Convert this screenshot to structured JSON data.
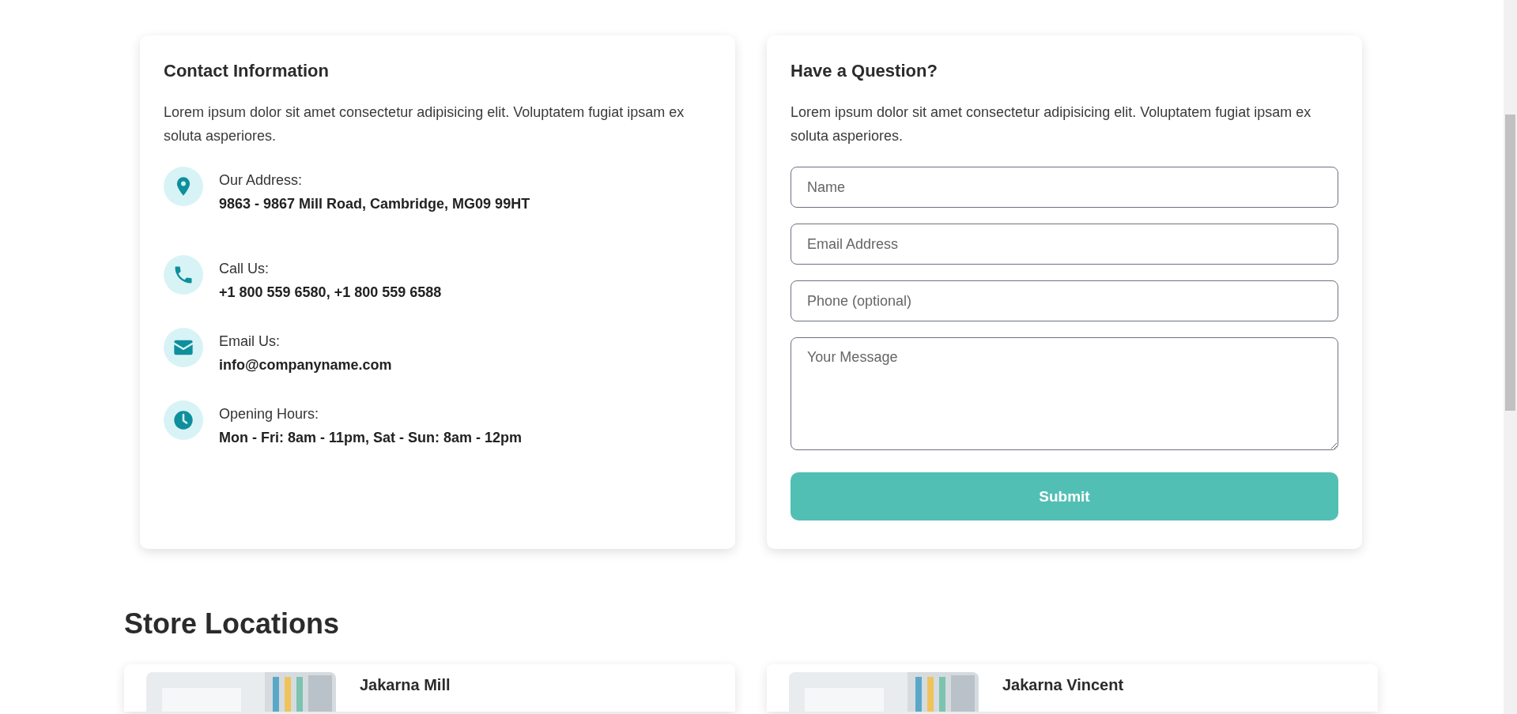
{
  "contact": {
    "title": "Contact Information",
    "intro": "Lorem ipsum dolor sit amet consectetur adipisicing elit. Voluptatem fugiat ipsam ex soluta asperiores.",
    "items": [
      {
        "kind": "pin",
        "label": "Our Address:",
        "value": "9863 - 9867 Mill Road, Cambridge, MG09 99HT"
      },
      {
        "kind": "phone",
        "label": "Call Us:",
        "value": "+1 800 559 6580, +1 800 559 6588"
      },
      {
        "kind": "mail",
        "label": "Email Us:",
        "value": "info@companyname.com"
      },
      {
        "kind": "clock",
        "label": "Opening Hours:",
        "value": "Mon - Fri: 8am - 11pm, Sat - Sun: 8am - 12pm"
      }
    ]
  },
  "question": {
    "title": "Have a Question?",
    "intro": "Lorem ipsum dolor sit amet consectetur adipisicing elit. Voluptatem fugiat ipsam ex soluta asperiores.",
    "fields": [
      {
        "kind": "input",
        "placeholder": "Name"
      },
      {
        "kind": "input",
        "placeholder": "Email Address"
      },
      {
        "kind": "input",
        "placeholder": "Phone (optional)"
      },
      {
        "kind": "textarea",
        "placeholder": "Your Message"
      }
    ],
    "submit": "Submit"
  },
  "stores": {
    "title": "Store Locations",
    "items": [
      {
        "name": "Jakarna Mill"
      },
      {
        "name": "Jakarna Vincent"
      }
    ]
  }
}
